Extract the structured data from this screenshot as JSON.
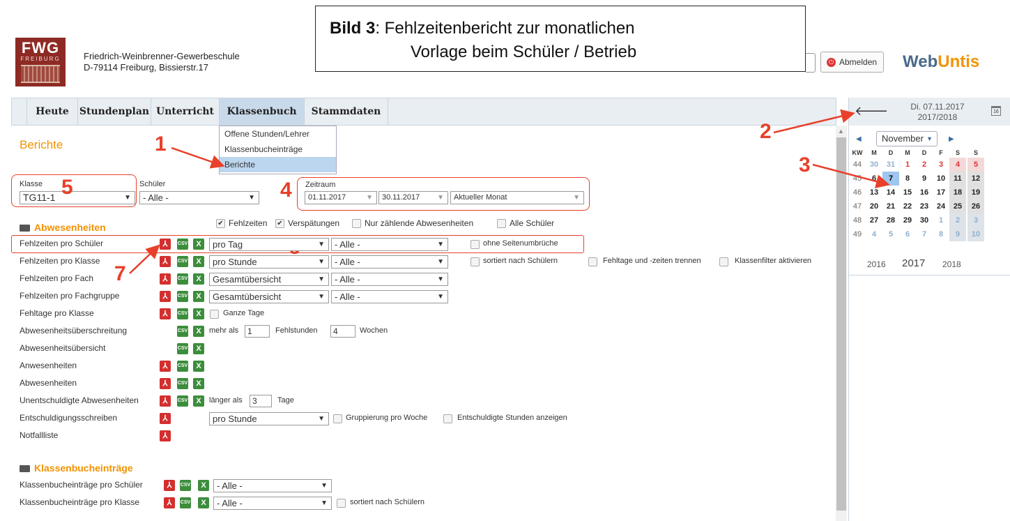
{
  "school": {
    "logo": "FWG",
    "logo_sub": "FREIBURG",
    "line1": "Friedrich-Weinbrenner-Gewerbeschule",
    "line2": "D-79114 Freiburg, Bissierstr.17"
  },
  "callout": {
    "bold": "Bild 3",
    "text1": ":  Fehlzeitenbericht zur monatlichen",
    "text2": "Vorlage beim Schüler / Betrieb"
  },
  "header": {
    "logout": "Abmelden",
    "brand_a": "Web",
    "brand_b": "Untis"
  },
  "nav": [
    "Heute",
    "Stundenplan",
    "Unterricht",
    "Klassenbuch",
    "Stammdaten"
  ],
  "dropdown": [
    "Offene Stunden/Lehrer",
    "Klassenbucheinträge",
    "Berichte"
  ],
  "page_title": "Berichte",
  "markers": {
    "m1": "1",
    "m2": "2",
    "m3": "3",
    "m4": "4",
    "m5": "5",
    "m6": "6",
    "m7": "7"
  },
  "filters": {
    "klasse_label": "Klasse",
    "klasse_value": "TG11-1",
    "schueler_label": "Schüler",
    "schueler_value": "- Alle -",
    "zeitraum_label": "Zeitraum",
    "from": "01.11.2017",
    "to": "30.11.2017",
    "period": "Aktueller Monat"
  },
  "checks": {
    "fehlzeiten": "Fehlzeiten",
    "verspaetungen": "Verspätungen",
    "nur_zaehlende": "Nur zählende Abwesenheiten",
    "alle_schueler": "Alle Schüler"
  },
  "sections": {
    "abw": "Abwesenheiten",
    "kb": "Klassenbucheinträge"
  },
  "rows": {
    "r1": {
      "label": "Fehlzeiten pro Schüler",
      "sel1": "pro Tag",
      "sel2": "- Alle -",
      "cb": "ohne Seitenumbrüche"
    },
    "r2": {
      "label": "Fehlzeiten pro Klasse",
      "sel1": "pro Stunde",
      "sel2": "- Alle -",
      "cb1": "sortiert nach Schülern",
      "cb2": "Fehltage und -zeiten trennen",
      "cb3": "Klassenfilter aktivieren"
    },
    "r3": {
      "label": "Fehlzeiten pro Fach",
      "sel1": "Gesamtübersicht",
      "sel2": "- Alle -"
    },
    "r4": {
      "label": "Fehlzeiten pro Fachgruppe",
      "sel1": "Gesamtübersicht",
      "sel2": "- Alle -"
    },
    "r5": {
      "label": "Fehltage pro Klasse",
      "cb": "Ganze Tage"
    },
    "r6": {
      "label": "Abwesenheitsüberschreitung",
      "pre": "mehr als",
      "v1": "1",
      "mid": "Fehlstunden",
      "v2": "4",
      "post": "Wochen"
    },
    "r7": {
      "label": "Abwesenheitsübersicht"
    },
    "r8": {
      "label": "Anwesenheiten"
    },
    "r9": {
      "label": "Abwesenheiten"
    },
    "r10": {
      "label": "Unentschuldigte Abwesenheiten",
      "pre": "länger als",
      "v": "3",
      "post": "Tage"
    },
    "r11": {
      "label": "Entschuldigungsschreiben",
      "sel1": "pro Stunde",
      "cb1": "Gruppierung pro Woche",
      "cb2": "Entschuldigte Stunden anzeigen"
    },
    "r12": {
      "label": "Notfallliste"
    },
    "k1": {
      "label": "Klassenbucheinträge pro Schüler",
      "sel": "- Alle -"
    },
    "k2": {
      "label": "Klassenbucheinträge pro Klasse",
      "sel": "- Alle -",
      "cb": "sortiert nach Schülern"
    }
  },
  "icons": {
    "pdf": "pdf-icon",
    "csv": "csv-icon",
    "xls": "excel-icon",
    "csv_text": "CSV",
    "xls_text": "X",
    "pdf_text": "⅄"
  },
  "sidebar": {
    "date": "Di. 07.11.2017",
    "year": "2017/2018",
    "cal_icon": "16",
    "month": "November",
    "years": [
      "2016",
      "2017",
      "2018"
    ],
    "weekday_header": [
      "KW",
      "M",
      "D",
      "M",
      "D",
      "F",
      "S",
      "S"
    ],
    "weeks": [
      [
        "44",
        "30",
        "31",
        "1",
        "2",
        "3",
        "4",
        "5"
      ],
      [
        "45",
        "6",
        "7",
        "8",
        "9",
        "10",
        "11",
        "12"
      ],
      [
        "46",
        "13",
        "14",
        "15",
        "16",
        "17",
        "18",
        "19"
      ],
      [
        "47",
        "20",
        "21",
        "22",
        "23",
        "24",
        "25",
        "26"
      ],
      [
        "48",
        "27",
        "28",
        "29",
        "30",
        "1",
        "2",
        "3"
      ],
      [
        "49",
        "4",
        "5",
        "6",
        "7",
        "8",
        "9",
        "10"
      ]
    ]
  }
}
